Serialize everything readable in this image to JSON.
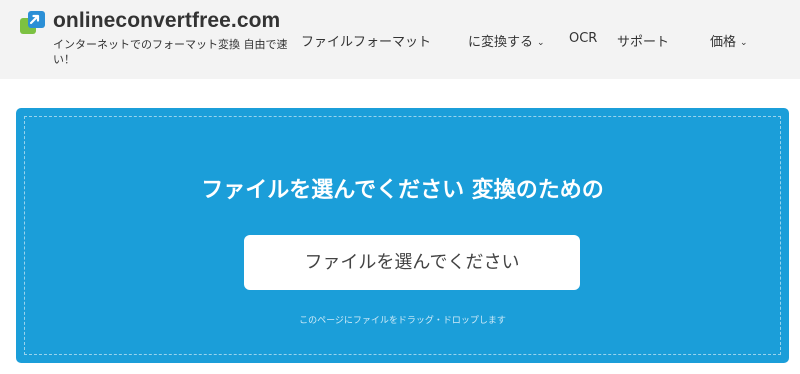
{
  "brand": {
    "logo_icon": "arrow-swap-icon",
    "name": "onlineconvertfree.com",
    "tagline": "インターネットでのフォーマット変換 自由で速い！"
  },
  "nav": {
    "formats_label": "ファイルフォーマット",
    "convert_label": "に変換する",
    "ocr_label": "OCR",
    "support_label": "サポート",
    "pricing_label": "価格",
    "dropdown_icon": "chevron-down-icon"
  },
  "converter": {
    "title": "ファイルを選んでください 変換のための",
    "choose_button": "ファイルを選んでください",
    "drop_hint": "このページにファイルをドラッグ・ドロップします"
  },
  "colors": {
    "header_bg": "#f3f3f3",
    "panel_bg": "#1b9ed9",
    "logo_blue": "#2b8fd6",
    "logo_green": "#7cc142"
  }
}
